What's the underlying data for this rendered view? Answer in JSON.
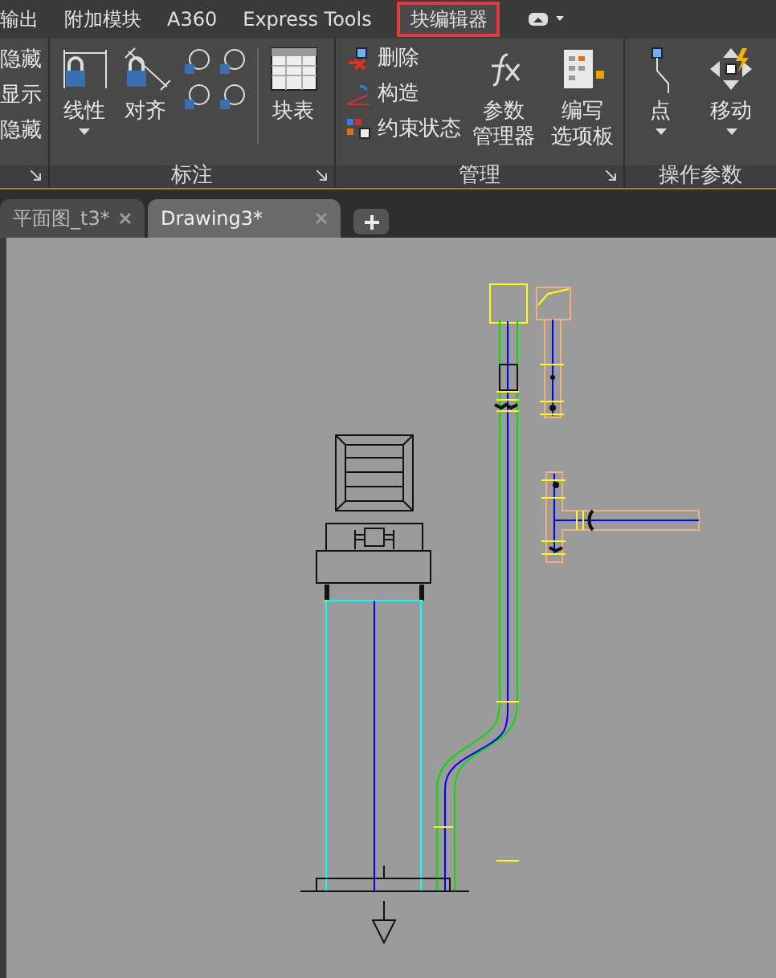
{
  "ribbon_tabs": [
    {
      "label": "输出",
      "selected": false
    },
    {
      "label": "附加模块",
      "selected": false
    },
    {
      "label": "A360",
      "selected": false
    },
    {
      "label": "Express Tools",
      "selected": false
    },
    {
      "label": "块编辑器",
      "selected": true
    }
  ],
  "ribbon": {
    "visibility_items": [
      "隐藏",
      "显示",
      "隐藏"
    ],
    "dimension_panel": {
      "title": "标注",
      "large_buttons": [
        {
          "kind": "linear",
          "lines": [
            "线性"
          ],
          "dropdown": true
        },
        {
          "kind": "aligned",
          "lines": [
            "对齐"
          ],
          "dropdown": false
        }
      ],
      "block_table": {
        "lines": [
          "块表"
        ]
      }
    },
    "manage_panel": {
      "title": "管理",
      "small_buttons": [
        {
          "kind": "erase",
          "label": "删除"
        },
        {
          "kind": "construction",
          "label": "构造"
        },
        {
          "kind": "constraint",
          "label": "约束状态"
        }
      ],
      "large_buttons": [
        {
          "kind": "fx",
          "lines": [
            "参数",
            "管理器"
          ]
        },
        {
          "kind": "palette",
          "lines": [
            "编写",
            "选项板"
          ]
        }
      ]
    },
    "action_panel": {
      "title": "操作参数",
      "large_buttons": [
        {
          "kind": "point",
          "lines": [
            "点"
          ],
          "dropdown": true
        },
        {
          "kind": "move",
          "lines": [
            "移动"
          ],
          "dropdown": true
        }
      ]
    }
  },
  "document_tabs": [
    {
      "label": "平面图_t3*",
      "selected": false
    },
    {
      "label": "Drawing3*",
      "selected": true
    }
  ]
}
